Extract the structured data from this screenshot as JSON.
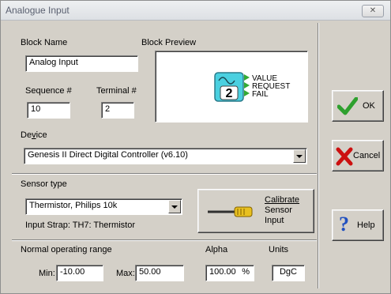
{
  "window": {
    "title": "Analogue Input"
  },
  "block_name": {
    "label": "Block Name",
    "value": "Analog Input"
  },
  "sequence": {
    "label": "Sequence #",
    "value": "10"
  },
  "terminal": {
    "label": "Terminal #",
    "value": "2"
  },
  "preview": {
    "label": "Block Preview",
    "block_number": "2",
    "outputs": [
      "VALUE",
      "REQUEST",
      "FAIL"
    ]
  },
  "device": {
    "label": "Device",
    "label_underline": "v",
    "value": "Genesis II Direct Digital Controller (v6.10)"
  },
  "sensor": {
    "label": "Sensor type",
    "value": "Thermistor, Philips 10k",
    "strap": "Input Strap: TH7: Thermistor",
    "calibrate_lines": [
      "Calibrate",
      "Sensor",
      "Input"
    ]
  },
  "range": {
    "label": "Normal operating range",
    "min_label": "Min:",
    "min_value": "-10.00",
    "max_label": "Max:",
    "max_value": "50.00"
  },
  "alpha": {
    "label": "Alpha",
    "value": "100.00",
    "unit": "%"
  },
  "units": {
    "label": "Units",
    "value": "DgC"
  },
  "buttons": {
    "ok": "OK",
    "cancel": "Cancel",
    "help": "Help"
  },
  "colors": {
    "ok_check": "#2ea02e",
    "cancel_x": "#cc1010",
    "help_q": "#2050c0",
    "block_fill": "#4ad0e0",
    "block_outline": "#2a7a8a"
  }
}
